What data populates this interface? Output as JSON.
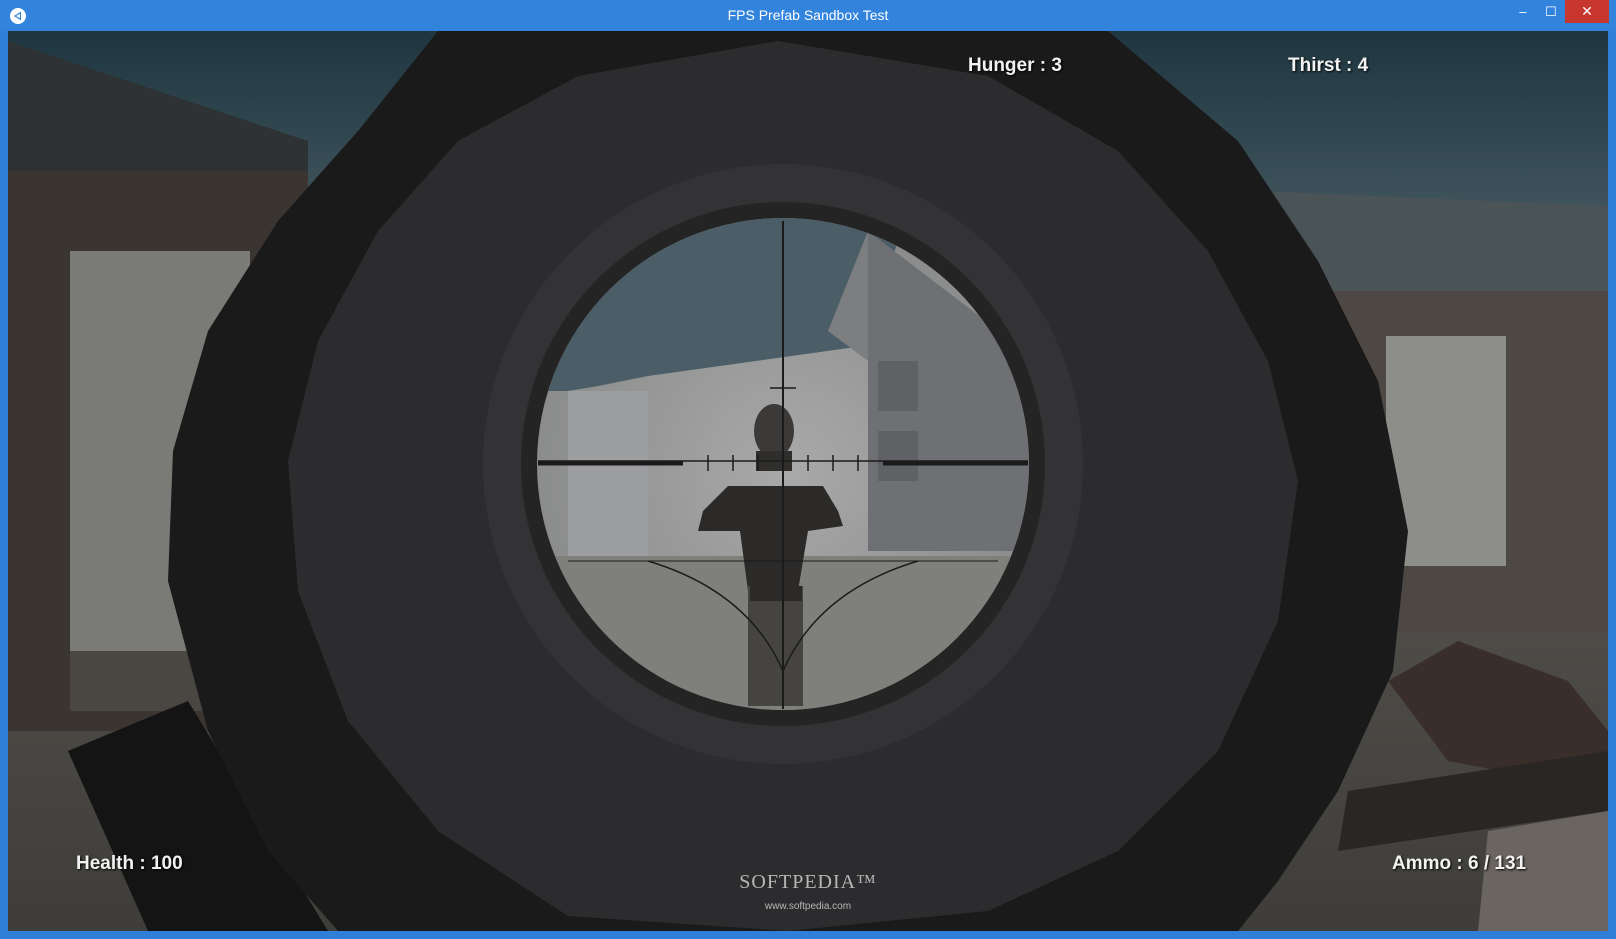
{
  "window": {
    "title": "FPS Prefab Sandbox Test",
    "minimize_glyph": "–",
    "maximize_glyph": "☐",
    "close_glyph": "✕",
    "icon": "unity-icon"
  },
  "hud": {
    "hunger": "Hunger : 3",
    "thirst": "Thirst : 4",
    "health": "Health : 100",
    "ammo": "Ammo : 6 / 131"
  },
  "watermark": {
    "brand": "SOFTPEDIA™",
    "url": "www.softpedia.com"
  },
  "colors": {
    "titlebar": "#3183dc",
    "close_button": "#c7372f",
    "hud_text": "#f2f2f2"
  }
}
